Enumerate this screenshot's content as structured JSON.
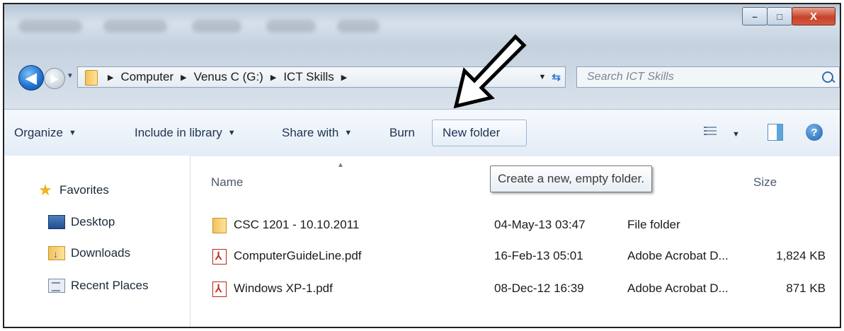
{
  "window": {
    "controls": {
      "minimize": "–",
      "maximize": "□",
      "close": "X"
    }
  },
  "nav": {
    "breadcrumbs": [
      "Computer",
      "Venus C (G:)",
      "ICT Skills"
    ],
    "search_placeholder": "Search ICT Skills"
  },
  "toolbar": {
    "organize": "Organize",
    "include_in_library": "Include in library",
    "share_with": "Share with",
    "burn": "Burn",
    "new_folder": "New folder",
    "help": "?"
  },
  "sidebar": {
    "favorites": "Favorites",
    "items": [
      "Desktop",
      "Downloads",
      "Recent Places"
    ]
  },
  "columns": {
    "name": "Name",
    "size": "Size"
  },
  "tooltip": "Create a new, empty folder.",
  "files": [
    {
      "name": "CSC 1201 - 10.10.2011",
      "date": "04-May-13 03:47",
      "type": "File folder",
      "size": "",
      "icon": "folder-icon"
    },
    {
      "name": "ComputerGuideLine.pdf",
      "date": "16-Feb-13 05:01",
      "type": "Adobe Acrobat D...",
      "size": "1,824 KB",
      "icon": "pdf-icon"
    },
    {
      "name": "Windows XP-1.pdf",
      "date": "08-Dec-12 16:39",
      "type": "Adobe Acrobat D...",
      "size": "871 KB",
      "icon": "pdf-icon"
    }
  ],
  "colors": {
    "toolbar_text": "#1d3350",
    "titlebar": "#c4d1de",
    "accent": "#1f6ed0"
  }
}
